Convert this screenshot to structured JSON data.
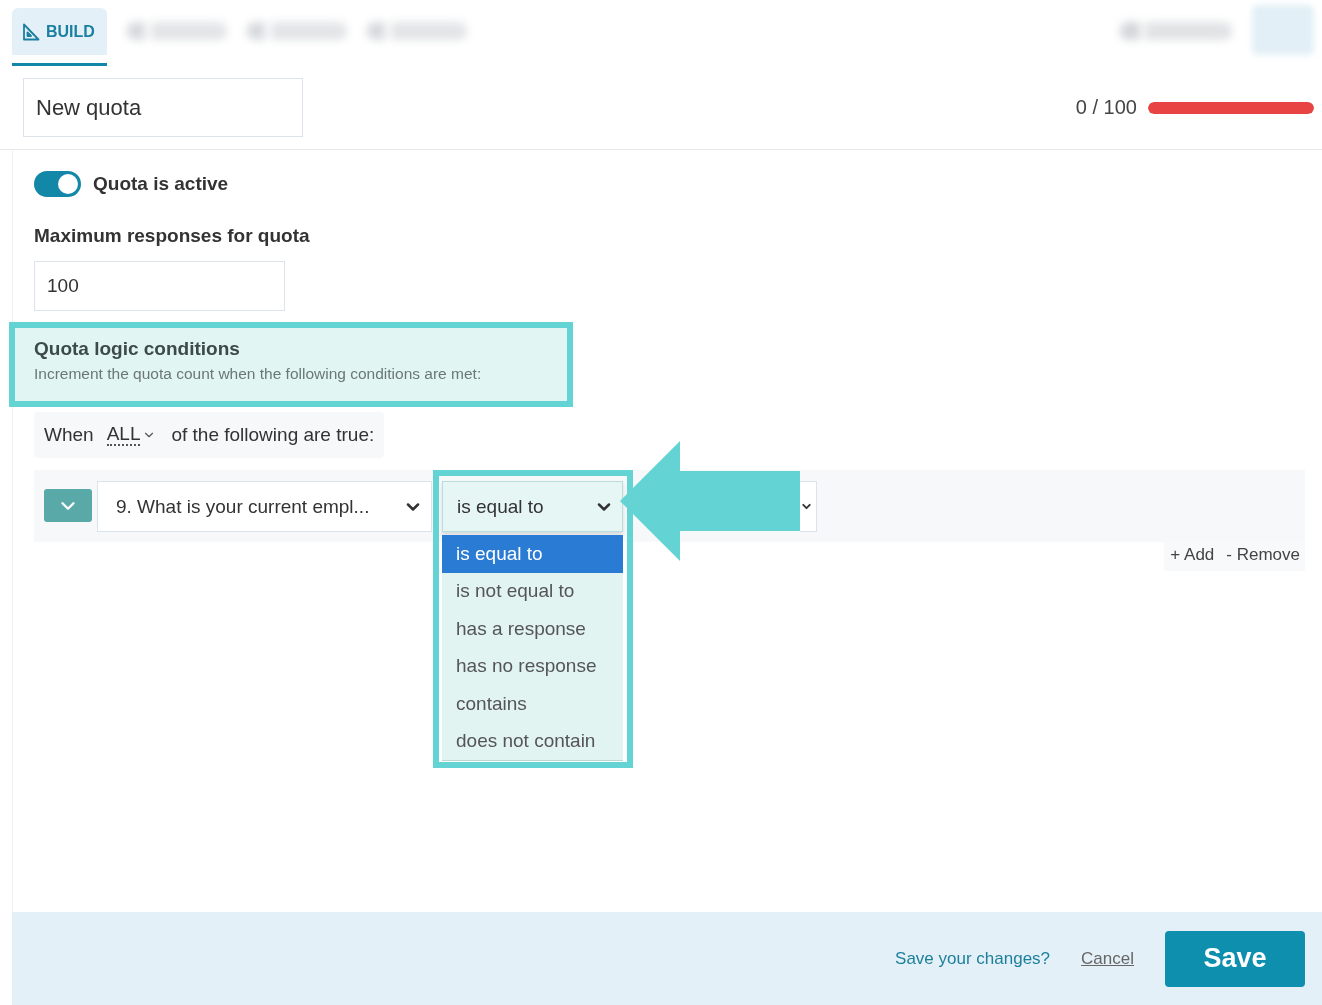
{
  "tabs": [
    {
      "kind": "labeled",
      "label": "BUILD",
      "selected": true
    },
    {
      "kind": "blurred",
      "selected": false
    },
    {
      "kind": "blurred",
      "selected": false
    },
    {
      "kind": "blurred",
      "selected": false
    }
  ],
  "header_actions": [
    {
      "kind": "button"
    },
    {
      "kind": "tile"
    }
  ],
  "quota": {
    "name": "New quota",
    "progress_text": "0 / 100",
    "level": 1
  },
  "active_toggle": {
    "label": "Quota is active",
    "on": true
  },
  "max_responses": {
    "label": "Maximum responses for quota",
    "value": "100"
  },
  "logic_conditions": {
    "title": "Quota logic conditions",
    "subtitle": "Increment the quota count when the following conditions are met:",
    "highlighted": true
  },
  "match": {
    "prefix": "When",
    "value": "ALL",
    "suffix": "of the following are true:"
  },
  "conditions": [
    {
      "expanded": true,
      "question": {
        "value": "9. What is your current empl..."
      },
      "operator": {
        "value": "is equal to",
        "open": true,
        "highlighted": true,
        "pointer_arrow": true,
        "options": [
          {
            "label": "is equal to",
            "selected": true
          },
          {
            "label": "is not equal to",
            "selected": false
          },
          {
            "label": "has a response",
            "selected": false
          },
          {
            "label": "has no response",
            "selected": false
          },
          {
            "label": "contains",
            "selected": false
          },
          {
            "label": "does not contain",
            "selected": false
          }
        ]
      },
      "answer": {
        "open": false
      }
    }
  ],
  "condition_actions": {
    "add": "+ Add",
    "remove": "- Remove"
  },
  "footer": {
    "prompt": "Save your changes?",
    "cancel": "Cancel",
    "save": "Save"
  }
}
